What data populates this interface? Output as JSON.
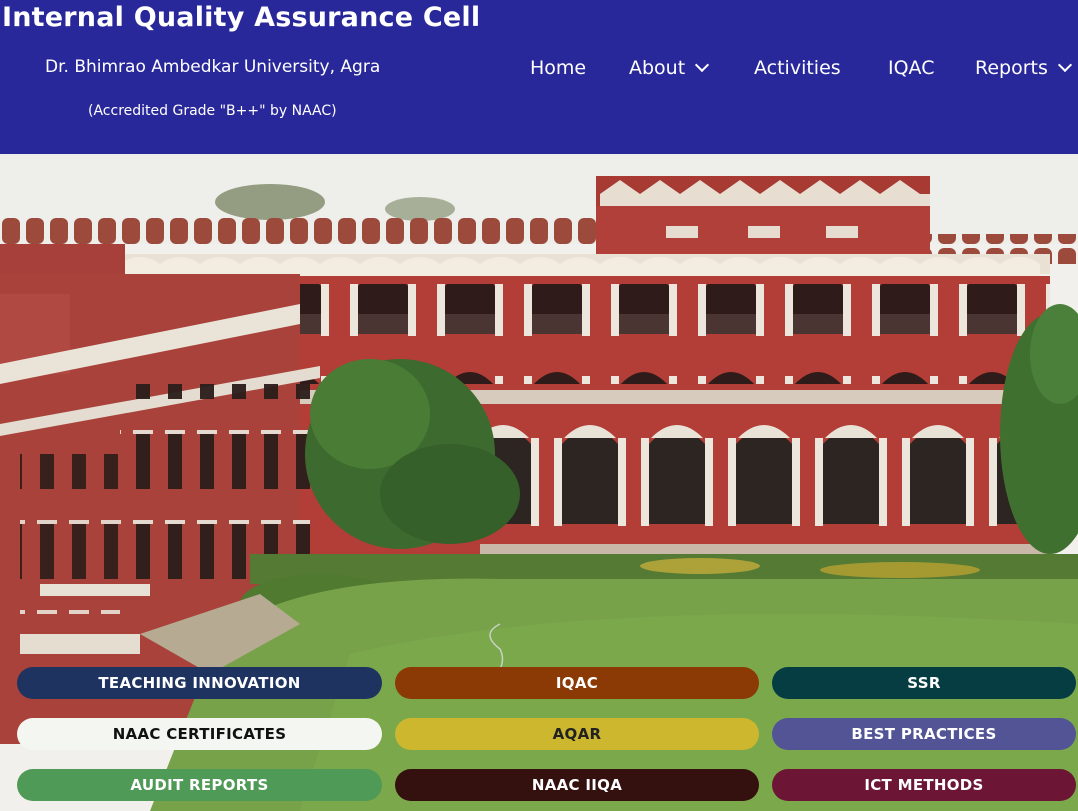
{
  "header": {
    "title": "Internal Quality Assurance Cell",
    "subtitle": "Dr. Bhimrao Ambedkar University, Agra",
    "accreditation": "(Accredited Grade \"B++\" by NAAC)",
    "nav": [
      {
        "label": "Home"
      },
      {
        "label": "About"
      },
      {
        "label": "Activities"
      },
      {
        "label": "IQAC"
      },
      {
        "label": "Reports"
      }
    ]
  },
  "hero": {
    "image": "red-brick-heritage-building-with-lawn"
  },
  "quick_links": [
    {
      "label": "TEACHING INNOVATION",
      "bg": "#1e3360",
      "fg": "#ffffff"
    },
    {
      "label": "IQAC",
      "bg": "#8b3a06",
      "fg": "#ffffff"
    },
    {
      "label": "SSR",
      "bg": "#053d42",
      "fg": "#ffffff"
    },
    {
      "label": "NAAC CERTIFICATES",
      "bg": "#f3f6f1",
      "fg": "#111111"
    },
    {
      "label": "AQAR",
      "bg": "#cdb72f",
      "fg": "#222222"
    },
    {
      "label": "BEST PRACTICES",
      "bg": "#525496",
      "fg": "#ffffff"
    },
    {
      "label": "AUDIT REPORTS",
      "bg": "#4f9a57",
      "fg": "#ffffff"
    },
    {
      "label": "NAAC IIQA",
      "bg": "#34100f",
      "fg": "#ffffff"
    },
    {
      "label": "ICT METHODS",
      "bg": "#6c1534",
      "fg": "#ffffff"
    }
  ]
}
